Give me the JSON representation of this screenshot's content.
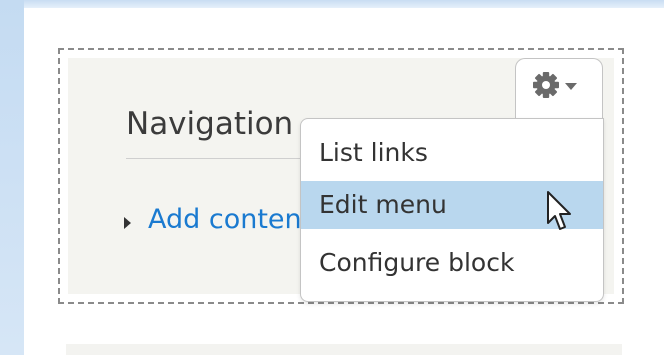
{
  "block": {
    "title": "Navigation",
    "menu_links": [
      {
        "label": "Add content"
      }
    ]
  },
  "contextual_menu": {
    "trigger_icon": "gear-icon",
    "trigger_caret_icon": "caret-down-icon",
    "items": [
      {
        "label": "List links",
        "active": false
      },
      {
        "label": "Edit menu",
        "active": true
      },
      {
        "label": "Configure block",
        "active": false
      }
    ]
  },
  "colors": {
    "link": "#1a7ad0",
    "menu_hover": "#b9d7ee",
    "page_edge": "#c6dcf1",
    "block_bg": "#f4f4f0"
  },
  "cursor_icon": "mouse-pointer-icon"
}
